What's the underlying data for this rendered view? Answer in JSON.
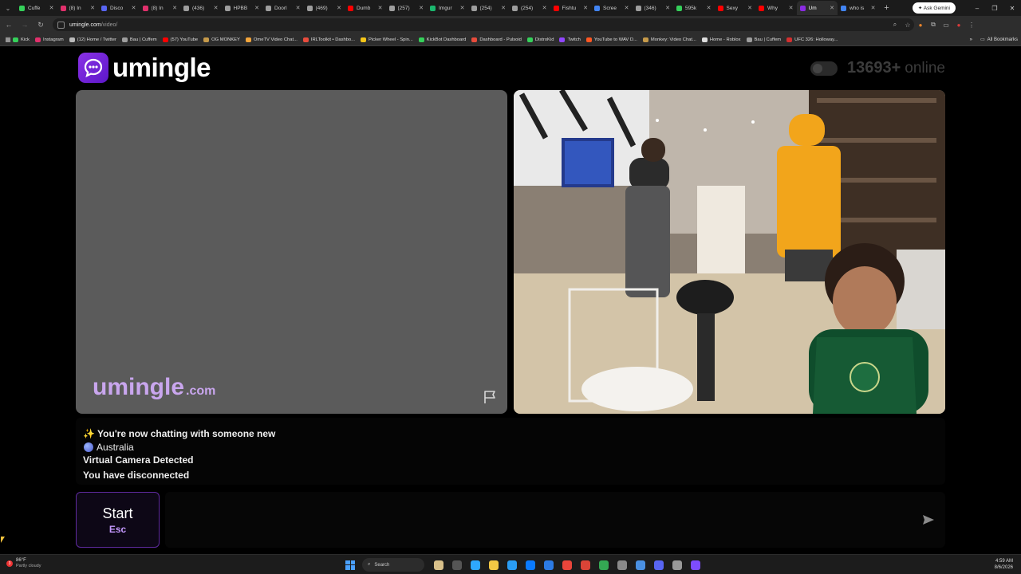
{
  "browser": {
    "tabs": [
      {
        "label": "Cuffe",
        "color": "#35d05a"
      },
      {
        "label": "(8) In",
        "color": "#e1306c"
      },
      {
        "label": "Disco",
        "color": "#5865f2"
      },
      {
        "label": "(8) In",
        "color": "#e1306c"
      },
      {
        "label": "(436)",
        "color": "#9e9e9e"
      },
      {
        "label": "HPBB",
        "color": "#9e9e9e"
      },
      {
        "label": "Doorl",
        "color": "#9e9e9e"
      },
      {
        "label": "(469)",
        "color": "#9e9e9e"
      },
      {
        "label": "Dumb",
        "color": "#ff0000"
      },
      {
        "label": "(257)",
        "color": "#9e9e9e"
      },
      {
        "label": "Imgur",
        "color": "#1bb76e"
      },
      {
        "label": "(254)",
        "color": "#9e9e9e"
      },
      {
        "label": "(254)",
        "color": "#9e9e9e"
      },
      {
        "label": "Fishtu",
        "color": "#ff0000"
      },
      {
        "label": "Scree",
        "color": "#4285f4"
      },
      {
        "label": "(346)",
        "color": "#9e9e9e"
      },
      {
        "label": "595k",
        "color": "#35d05a"
      },
      {
        "label": "Sexy",
        "color": "#ff0000"
      },
      {
        "label": "Why",
        "color": "#ff0000"
      },
      {
        "label": "Um",
        "color": "#8a2be2",
        "active": true
      },
      {
        "label": "who is",
        "color": "#4285f4"
      }
    ],
    "gemini_label": "Ask Gemini",
    "url_host": "umingle.com",
    "url_path": "/video/",
    "bookmarks": [
      {
        "label": "Kick",
        "color": "#35d05a"
      },
      {
        "label": "Instagram",
        "color": "#e1306c"
      },
      {
        "label": "(12) Home / Twitter",
        "color": "#bbbbbb"
      },
      {
        "label": "Bau | Cuffem",
        "color": "#9e9e9e"
      },
      {
        "label": "(57) YouTube",
        "color": "#ff0000"
      },
      {
        "label": "OG MONKEY",
        "color": "#c69a4a"
      },
      {
        "label": "OmeTV Video Chat...",
        "color": "#f4a63b"
      },
      {
        "label": "IRLToolkit • Dashbo...",
        "color": "#e84c3d"
      },
      {
        "label": "Picker Wheel - Spin...",
        "color": "#f5c518"
      },
      {
        "label": "KickBot Dashboard",
        "color": "#35d05a"
      },
      {
        "label": "Dashboard - Pulsoid",
        "color": "#e74c3c"
      },
      {
        "label": "DistroKid",
        "color": "#35d05a"
      },
      {
        "label": "Twitch",
        "color": "#9146ff"
      },
      {
        "label": "YouTube to WAV D...",
        "color": "#ff5722"
      },
      {
        "label": "Monkey: Video Chat...",
        "color": "#c69a4a"
      },
      {
        "label": "Home - Roblox",
        "color": "#dddddd"
      },
      {
        "label": "Bau | Cuffem",
        "color": "#9e9e9e"
      },
      {
        "label": "UFC 326: Holloway...",
        "color": "#d32f2f"
      }
    ],
    "all_bookmarks_label": "All Bookmarks"
  },
  "site": {
    "logo_text": "umingle",
    "online_count": "13693+",
    "online_label": "online",
    "watermark_name": "umingle",
    "watermark_tld": ".com"
  },
  "chat": {
    "now_chatting": "✨ You're now chatting with someone new",
    "country": "Australia",
    "virtual_camera": "Virtual Camera Detected",
    "disconnected": "You have disconnected"
  },
  "controls": {
    "start_label": "Start",
    "start_key": "Esc",
    "message_placeholder": ""
  },
  "taskbar": {
    "weather_badge": "3",
    "temperature": "86°F",
    "weather": "Partly cloudy",
    "search_label": "Search",
    "time": "4:59 AM",
    "date": "8/6/2026",
    "app_colors": [
      "#d8c08a",
      "#555555",
      "#2ea8ff",
      "#f2c744",
      "#2a9df4",
      "#0a7aff",
      "#2c7be5",
      "#e9453b",
      "#db4437",
      "#34a853",
      "#8a8a8a",
      "#4a90e2",
      "#5865f2",
      "#9a9a9a",
      "#7d4cff"
    ]
  },
  "colors": {
    "accent": "#7b2ff2",
    "start_border": "#5e2a9e",
    "start_key": "#c599ff",
    "watermark": "#c9a6ee"
  }
}
